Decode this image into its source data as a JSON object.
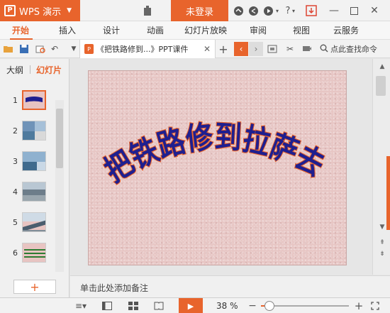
{
  "app": {
    "name": "WPS 演示",
    "logo_letter": "P",
    "login_label": "未登录",
    "brand_color": "#e8642c"
  },
  "title_icons": [
    "skin-icon",
    "cloud-icon",
    "share-icon",
    "play-circle-icon",
    "help-icon",
    "settings-icon",
    "download-update-icon",
    "minimize-icon",
    "maximize-icon",
    "close-icon"
  ],
  "menu": [
    "开始",
    "插入",
    "设计",
    "动画",
    "幻灯片放映",
    "审阅",
    "视图",
    "云服务"
  ],
  "menu_active": 0,
  "document_tab": {
    "title": "《把铁路修到...》PPT课件",
    "icon_letter": "P"
  },
  "search": {
    "label": "点此查找命令"
  },
  "left_panel": {
    "tabs": [
      "大纲",
      "幻灯片"
    ],
    "active_tab": 1,
    "slides": [
      {
        "number": "1",
        "selected": true
      },
      {
        "number": "2",
        "selected": false
      },
      {
        "number": "3",
        "selected": false
      },
      {
        "number": "4",
        "selected": false
      },
      {
        "number": "5",
        "selected": false
      },
      {
        "number": "6",
        "selected": false
      }
    ],
    "add_label": "+"
  },
  "slide": {
    "title": "把铁路修到拉萨去",
    "title_color": "#1f1f8f",
    "outline_color": "#e8642c"
  },
  "notes": {
    "placeholder": "单击此处添加备注"
  },
  "status": {
    "zoom": "38 %",
    "zoom_fraction": 0.1
  }
}
